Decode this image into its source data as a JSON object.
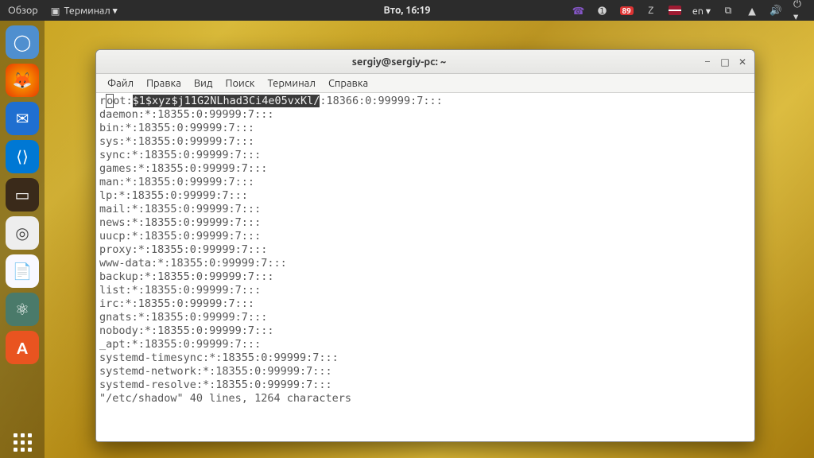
{
  "topbar": {
    "overview": "Обзор",
    "app_indicator": "Терминал ▾",
    "clock": "Вто, 16:19",
    "updates_badge": "89",
    "lang": "en ▾"
  },
  "dock": {
    "items": [
      {
        "name": "chromium",
        "color": "#5b9bd5",
        "glyph": "◯"
      },
      {
        "name": "firefox",
        "color": "#ff7139",
        "glyph": "🦊"
      },
      {
        "name": "thunderbird",
        "color": "#1f6fd0",
        "glyph": "✉"
      },
      {
        "name": "vscode",
        "color": "#0078d4",
        "glyph": "⟨⟩"
      },
      {
        "name": "screenshot",
        "color": "#8a5a3a",
        "glyph": "▭"
      },
      {
        "name": "disks",
        "color": "#d9d9d9",
        "glyph": "◎"
      },
      {
        "name": "libreoffice",
        "color": "#eef",
        "glyph": "📄"
      },
      {
        "name": "atom",
        "color": "#5fc9a4",
        "glyph": "⚛"
      },
      {
        "name": "software",
        "color": "#e95420",
        "glyph": "A"
      }
    ]
  },
  "window": {
    "title": "sergiy@sergiy-pc: ~",
    "menu": [
      "Файл",
      "Правка",
      "Вид",
      "Поиск",
      "Терминал",
      "Справка"
    ],
    "controls": {
      "min": "–",
      "max": "□",
      "close": "✕"
    }
  },
  "terminal": {
    "first_line": {
      "pre": "r",
      "boxed": "o",
      "post": "ot:",
      "highlighted": "$1$xyz$j11G2NLhad3Ci4e05vxKl/",
      "tail": ":18366:0:99999:7:::"
    },
    "lines": [
      "daemon:*:18355:0:99999:7:::",
      "bin:*:18355:0:99999:7:::",
      "sys:*:18355:0:99999:7:::",
      "sync:*:18355:0:99999:7:::",
      "games:*:18355:0:99999:7:::",
      "man:*:18355:0:99999:7:::",
      "lp:*:18355:0:99999:7:::",
      "mail:*:18355:0:99999:7:::",
      "news:*:18355:0:99999:7:::",
      "uucp:*:18355:0:99999:7:::",
      "proxy:*:18355:0:99999:7:::",
      "www-data:*:18355:0:99999:7:::",
      "backup:*:18355:0:99999:7:::",
      "list:*:18355:0:99999:7:::",
      "irc:*:18355:0:99999:7:::",
      "gnats:*:18355:0:99999:7:::",
      "nobody:*:18355:0:99999:7:::",
      "_apt:*:18355:0:99999:7:::",
      "systemd-timesync:*:18355:0:99999:7:::",
      "systemd-network:*:18355:0:99999:7:::",
      "systemd-resolve:*:18355:0:99999:7:::"
    ],
    "status": "\"/etc/shadow\" 40 lines, 1264 characters"
  }
}
